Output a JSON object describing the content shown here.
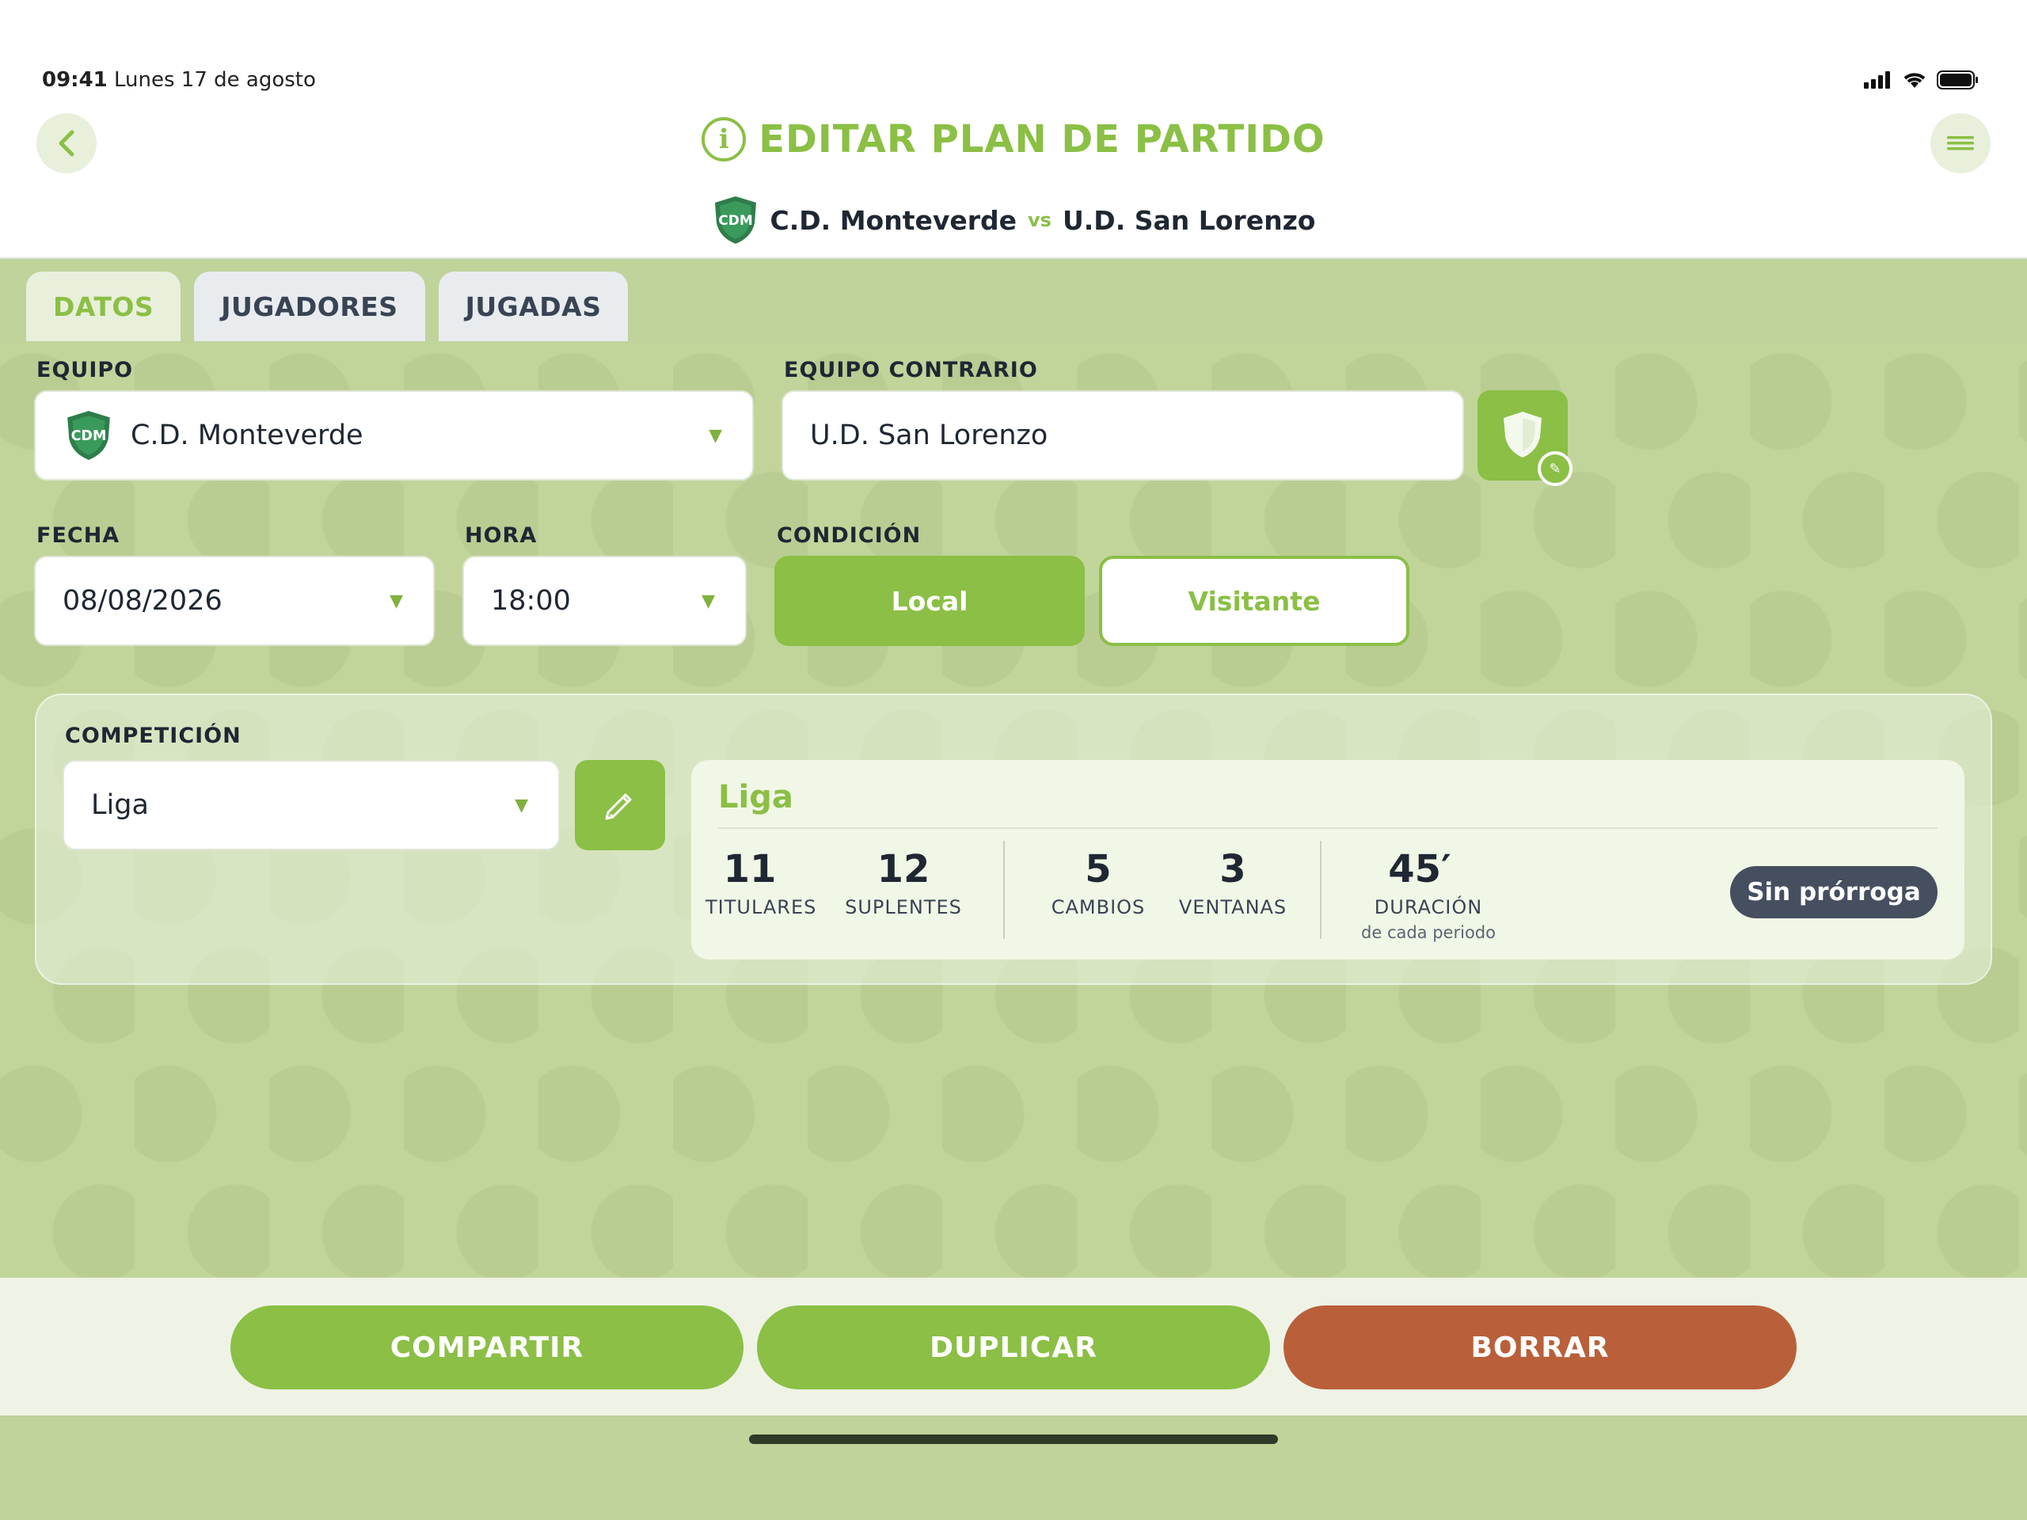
{
  "status": {
    "time": "09:41",
    "date": "Lunes 17 de agosto"
  },
  "header": {
    "title": "EDITAR PLAN DE PARTIDO",
    "team_home": "C.D. Monteverde",
    "vs": "vs",
    "team_away": "U.D. San Lorenzo",
    "crest_text": "CDM"
  },
  "tabs": [
    {
      "label": "DATOS",
      "active": true
    },
    {
      "label": "JUGADORES",
      "active": false
    },
    {
      "label": "JUGADAS",
      "active": false
    }
  ],
  "form": {
    "equipo_label": "EQUIPO",
    "equipo_value": "C.D. Monteverde",
    "contrario_label": "EQUIPO CONTRARIO",
    "contrario_value": "U.D. San Lorenzo",
    "fecha_label": "FECHA",
    "fecha_value": "08/08/2026",
    "hora_label": "HORA",
    "hora_value": "18:00",
    "condicion_label": "CONDICIÓN",
    "condicion_options": [
      "Local",
      "Visitante"
    ],
    "condicion_selected": "Local"
  },
  "competition": {
    "label": "COMPETICIÓN",
    "value": "Liga",
    "card_title": "Liga",
    "stats": [
      {
        "value": "11",
        "label": "TITULARES"
      },
      {
        "value": "12",
        "label": "SUPLENTES"
      },
      {
        "value": "5",
        "label": "CAMBIOS"
      },
      {
        "value": "3",
        "label": "VENTANAS"
      },
      {
        "value": "45′",
        "label": "DURACIÓN",
        "sub": "de cada periodo"
      }
    ],
    "badge": "Sin prórroga"
  },
  "actions": {
    "share": "COMPARTIR",
    "duplicate": "DUPLICAR",
    "delete": "BORRAR"
  },
  "colors": {
    "accent": "#8bbf45",
    "danger": "#b9603a",
    "dark": "#1f2733"
  },
  "icons": [
    "back-icon",
    "info-icon",
    "menu-icon",
    "crest-icon",
    "shield-icon",
    "edit-icon",
    "pencil-icon",
    "caret-down-icon"
  ]
}
